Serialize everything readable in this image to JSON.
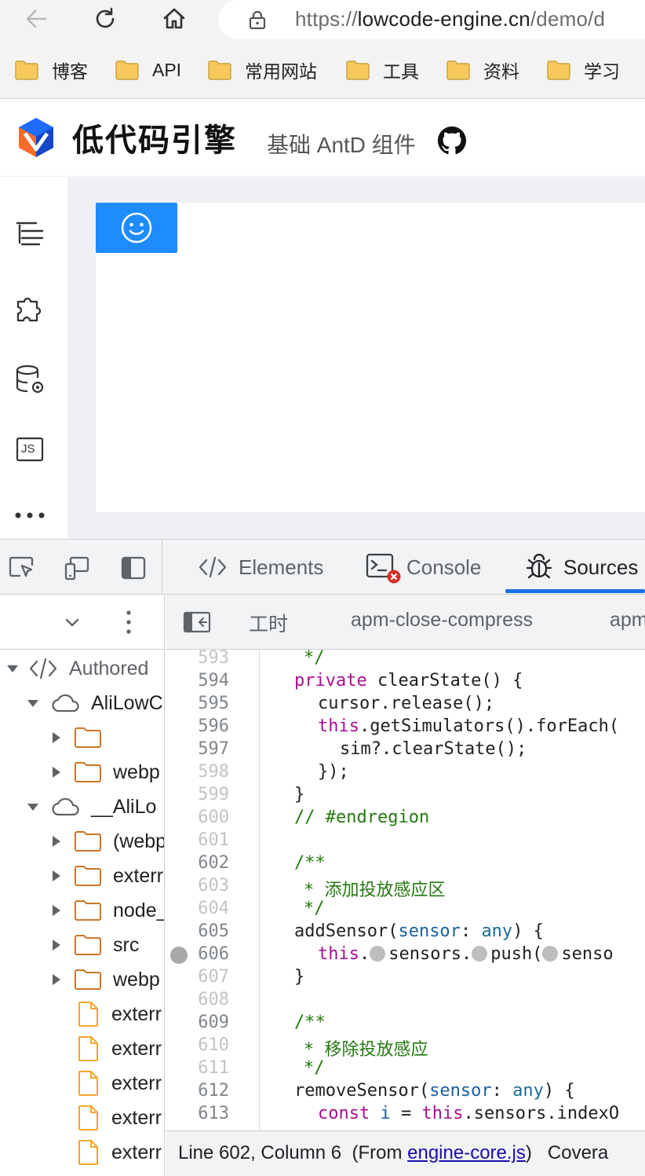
{
  "browser": {
    "url_prefix": "https://",
    "url_host": "lowcode-engine.cn",
    "url_path": "/demo/d",
    "bookmarks": [
      {
        "label": "博客"
      },
      {
        "label": "API"
      },
      {
        "label": "常用网站"
      },
      {
        "label": "工具"
      },
      {
        "label": "资料"
      },
      {
        "label": "学习"
      }
    ]
  },
  "app": {
    "logo_text": "低代码引擎",
    "subtitle": "基础 AntD 组件",
    "left_panel_icons": [
      "outline-tree-icon",
      "puzzle-plugin-icon",
      "datasource-icon",
      "js-code-icon",
      "more-icon"
    ],
    "js_label": "JS",
    "colors": {
      "accent": "#1e8cff"
    }
  },
  "devtools": {
    "tabs": [
      {
        "label": "Elements"
      },
      {
        "label": "Console"
      },
      {
        "label": "Sources"
      }
    ],
    "navigator": {
      "tree": [
        {
          "label": "Authored"
        },
        {
          "label": "AliLowC"
        },
        {
          "label": ""
        },
        {
          "label": "webp"
        },
        {
          "label": "__AliLo"
        },
        {
          "label": "(webp"
        },
        {
          "label": "exterr"
        },
        {
          "label": "node_"
        },
        {
          "label": "src"
        },
        {
          "label": "webp"
        },
        {
          "label": "exterr"
        },
        {
          "label": "exterr"
        },
        {
          "label": "exterr"
        },
        {
          "label": "exterr"
        },
        {
          "label": "exterr"
        }
      ]
    },
    "editor_tabs": [
      {
        "label": "工时"
      },
      {
        "label": "apm-close-compress"
      },
      {
        "label": "apm"
      }
    ],
    "line_numbers": [
      "593",
      "594",
      "595",
      "596",
      "597",
      "598",
      "599",
      "600",
      "601",
      "602",
      "603",
      "604",
      "605",
      "606",
      "607",
      "608",
      "609",
      "610",
      "611",
      "612",
      "613"
    ],
    "code": {
      "l593": "*/",
      "l594_kw": "private",
      "l594_rest": " clearState() {",
      "l595": "cursor.release();",
      "l596_kw": "this",
      "l596_rest": ".getSimulators().forEach(",
      "l597": "sim?.clearState();",
      "l598": "});",
      "l599": "}",
      "l600": "// #endregion",
      "l602": "/**",
      "l603": "* 添加投放感应区",
      "l604": "*/",
      "l605_fn": "addSensor(",
      "l605_param": "sensor",
      "l605_colon": ": ",
      "l605_type": "any",
      "l605_end": ") {",
      "l606_kw": "this",
      "l606_a": ".",
      "l606_b": "sensors.",
      "l606_c": "push(",
      "l606_d": "senso",
      "l607": "}",
      "l609": "/**",
      "l610": "* 移除投放感应",
      "l611": "*/",
      "l612_fn": "removeSensor(",
      "l612_param": "sensor",
      "l612_colon": ": ",
      "l612_type": "any",
      "l612_end": ") {",
      "l613_kw": "const",
      "l613_var": " i",
      "l613_eq": " = ",
      "l613_kw2": "this",
      "l613_rest": ".sensors.indexO"
    },
    "status": {
      "position": "Line 602, Column 6",
      "from_prefix": "(From ",
      "from_file": "engine-core.js",
      "from_suffix": ")",
      "coverage": "Covera"
    }
  }
}
